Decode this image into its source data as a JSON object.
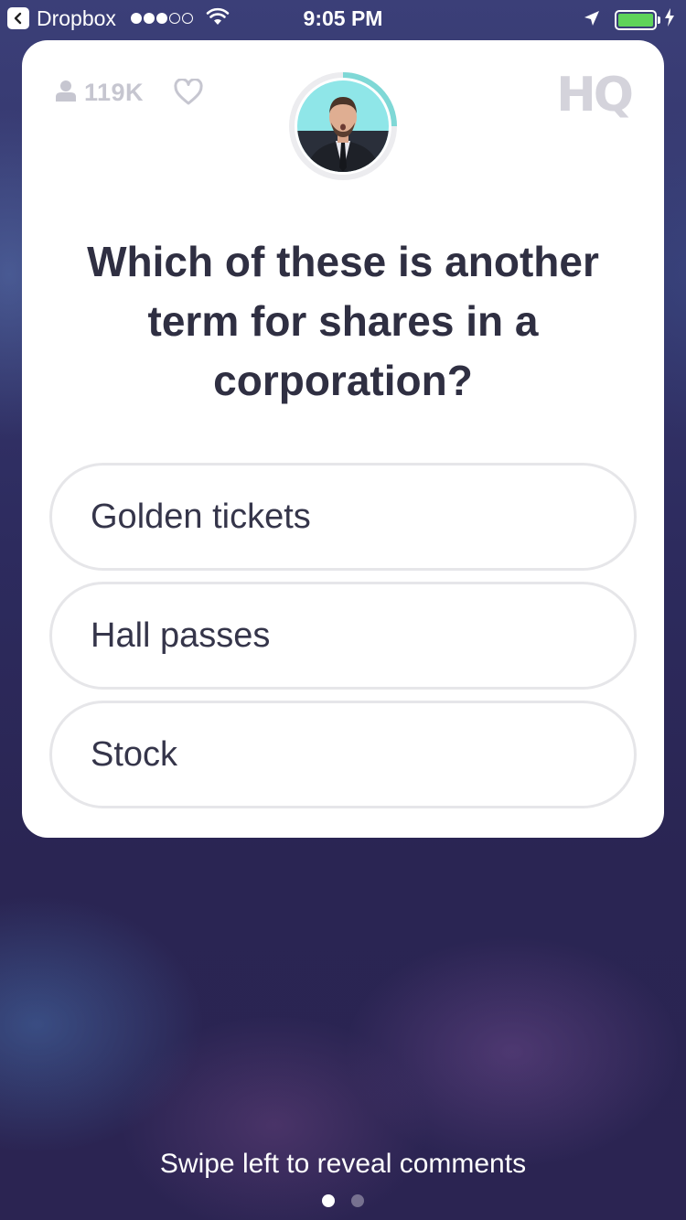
{
  "status_bar": {
    "back_app": "Dropbox",
    "time": "9:05 PM",
    "signal_bars_filled": 3,
    "signal_bars_total": 5,
    "battery_level": 1.0,
    "battery_color": "#5fd35a"
  },
  "header": {
    "viewers_count": "119K",
    "logo": "HQ"
  },
  "question": {
    "text": "Which of these is another term for shares in a corporation?"
  },
  "answers": [
    {
      "label": "Golden tickets"
    },
    {
      "label": "Hall passes"
    },
    {
      "label": "Stock"
    }
  ],
  "footer": {
    "swipe_hint": "Swipe left to reveal comments",
    "pages_total": 2,
    "current_page": 1
  },
  "colors": {
    "card_bg": "#ffffff",
    "text_dark": "#2f2f42",
    "answer_border": "#e6e6e9",
    "muted_gray": "#c6c6d0",
    "timer_accent": "#7fd8d6"
  }
}
